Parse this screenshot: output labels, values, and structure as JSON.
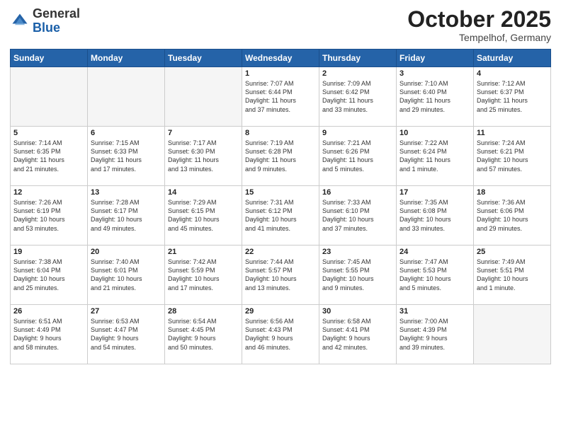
{
  "header": {
    "logo_general": "General",
    "logo_blue": "Blue",
    "month": "October 2025",
    "location": "Tempelhof, Germany"
  },
  "weekdays": [
    "Sunday",
    "Monday",
    "Tuesday",
    "Wednesday",
    "Thursday",
    "Friday",
    "Saturday"
  ],
  "weeks": [
    [
      {
        "day": "",
        "info": ""
      },
      {
        "day": "",
        "info": ""
      },
      {
        "day": "",
        "info": ""
      },
      {
        "day": "1",
        "info": "Sunrise: 7:07 AM\nSunset: 6:44 PM\nDaylight: 11 hours\nand 37 minutes."
      },
      {
        "day": "2",
        "info": "Sunrise: 7:09 AM\nSunset: 6:42 PM\nDaylight: 11 hours\nand 33 minutes."
      },
      {
        "day": "3",
        "info": "Sunrise: 7:10 AM\nSunset: 6:40 PM\nDaylight: 11 hours\nand 29 minutes."
      },
      {
        "day": "4",
        "info": "Sunrise: 7:12 AM\nSunset: 6:37 PM\nDaylight: 11 hours\nand 25 minutes."
      }
    ],
    [
      {
        "day": "5",
        "info": "Sunrise: 7:14 AM\nSunset: 6:35 PM\nDaylight: 11 hours\nand 21 minutes."
      },
      {
        "day": "6",
        "info": "Sunrise: 7:15 AM\nSunset: 6:33 PM\nDaylight: 11 hours\nand 17 minutes."
      },
      {
        "day": "7",
        "info": "Sunrise: 7:17 AM\nSunset: 6:30 PM\nDaylight: 11 hours\nand 13 minutes."
      },
      {
        "day": "8",
        "info": "Sunrise: 7:19 AM\nSunset: 6:28 PM\nDaylight: 11 hours\nand 9 minutes."
      },
      {
        "day": "9",
        "info": "Sunrise: 7:21 AM\nSunset: 6:26 PM\nDaylight: 11 hours\nand 5 minutes."
      },
      {
        "day": "10",
        "info": "Sunrise: 7:22 AM\nSunset: 6:24 PM\nDaylight: 11 hours\nand 1 minute."
      },
      {
        "day": "11",
        "info": "Sunrise: 7:24 AM\nSunset: 6:21 PM\nDaylight: 10 hours\nand 57 minutes."
      }
    ],
    [
      {
        "day": "12",
        "info": "Sunrise: 7:26 AM\nSunset: 6:19 PM\nDaylight: 10 hours\nand 53 minutes."
      },
      {
        "day": "13",
        "info": "Sunrise: 7:28 AM\nSunset: 6:17 PM\nDaylight: 10 hours\nand 49 minutes."
      },
      {
        "day": "14",
        "info": "Sunrise: 7:29 AM\nSunset: 6:15 PM\nDaylight: 10 hours\nand 45 minutes."
      },
      {
        "day": "15",
        "info": "Sunrise: 7:31 AM\nSunset: 6:12 PM\nDaylight: 10 hours\nand 41 minutes."
      },
      {
        "day": "16",
        "info": "Sunrise: 7:33 AM\nSunset: 6:10 PM\nDaylight: 10 hours\nand 37 minutes."
      },
      {
        "day": "17",
        "info": "Sunrise: 7:35 AM\nSunset: 6:08 PM\nDaylight: 10 hours\nand 33 minutes."
      },
      {
        "day": "18",
        "info": "Sunrise: 7:36 AM\nSunset: 6:06 PM\nDaylight: 10 hours\nand 29 minutes."
      }
    ],
    [
      {
        "day": "19",
        "info": "Sunrise: 7:38 AM\nSunset: 6:04 PM\nDaylight: 10 hours\nand 25 minutes."
      },
      {
        "day": "20",
        "info": "Sunrise: 7:40 AM\nSunset: 6:01 PM\nDaylight: 10 hours\nand 21 minutes."
      },
      {
        "day": "21",
        "info": "Sunrise: 7:42 AM\nSunset: 5:59 PM\nDaylight: 10 hours\nand 17 minutes."
      },
      {
        "day": "22",
        "info": "Sunrise: 7:44 AM\nSunset: 5:57 PM\nDaylight: 10 hours\nand 13 minutes."
      },
      {
        "day": "23",
        "info": "Sunrise: 7:45 AM\nSunset: 5:55 PM\nDaylight: 10 hours\nand 9 minutes."
      },
      {
        "day": "24",
        "info": "Sunrise: 7:47 AM\nSunset: 5:53 PM\nDaylight: 10 hours\nand 5 minutes."
      },
      {
        "day": "25",
        "info": "Sunrise: 7:49 AM\nSunset: 5:51 PM\nDaylight: 10 hours\nand 1 minute."
      }
    ],
    [
      {
        "day": "26",
        "info": "Sunrise: 6:51 AM\nSunset: 4:49 PM\nDaylight: 9 hours\nand 58 minutes."
      },
      {
        "day": "27",
        "info": "Sunrise: 6:53 AM\nSunset: 4:47 PM\nDaylight: 9 hours\nand 54 minutes."
      },
      {
        "day": "28",
        "info": "Sunrise: 6:54 AM\nSunset: 4:45 PM\nDaylight: 9 hours\nand 50 minutes."
      },
      {
        "day": "29",
        "info": "Sunrise: 6:56 AM\nSunset: 4:43 PM\nDaylight: 9 hours\nand 46 minutes."
      },
      {
        "day": "30",
        "info": "Sunrise: 6:58 AM\nSunset: 4:41 PM\nDaylight: 9 hours\nand 42 minutes."
      },
      {
        "day": "31",
        "info": "Sunrise: 7:00 AM\nSunset: 4:39 PM\nDaylight: 9 hours\nand 39 minutes."
      },
      {
        "day": "",
        "info": ""
      }
    ]
  ]
}
